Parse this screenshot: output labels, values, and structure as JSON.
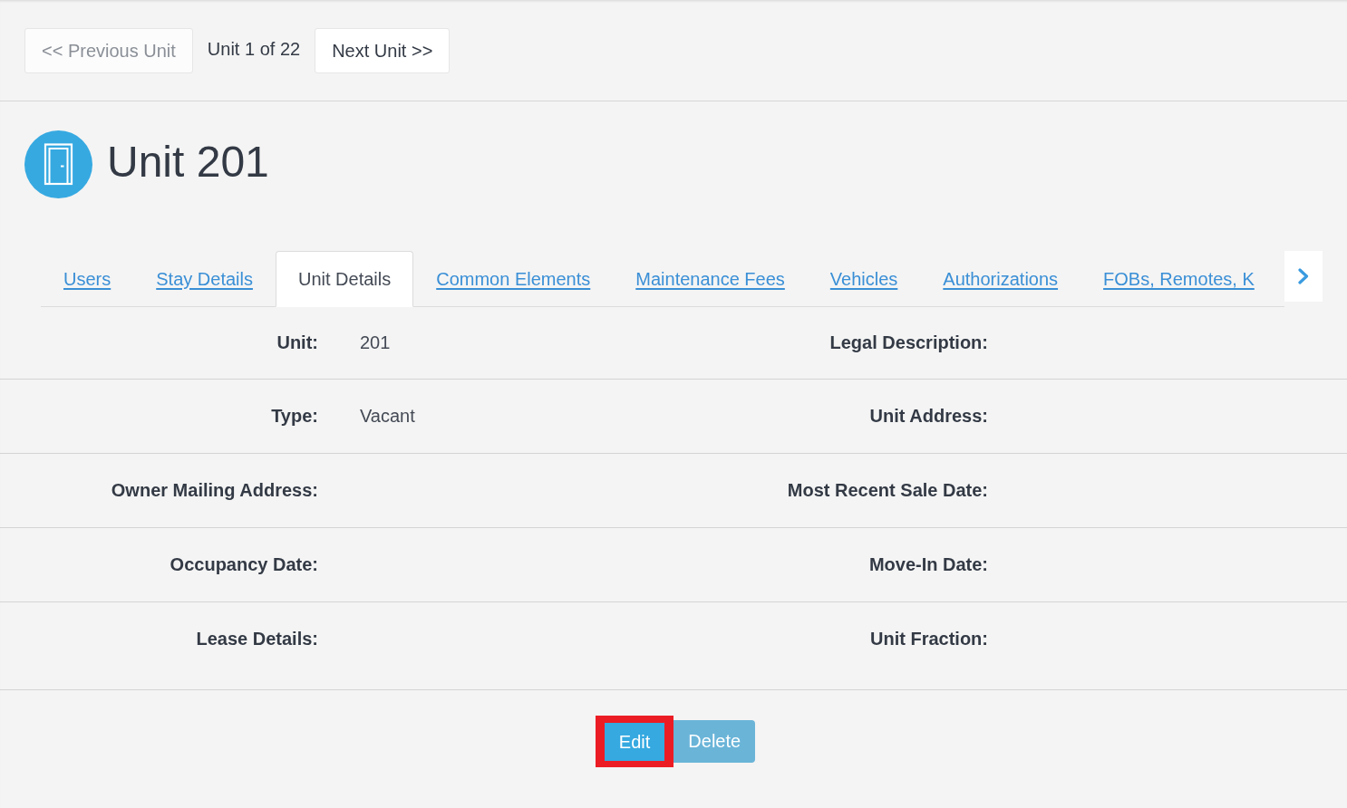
{
  "pager": {
    "previous": {
      "label": "<< Previous Unit",
      "disabled": true
    },
    "position": "Unit 1 of 22",
    "next": {
      "label": "Next Unit >>",
      "disabled": false
    }
  },
  "header": {
    "title": "Unit 201"
  },
  "tabs": [
    {
      "label": "Users",
      "selected": false
    },
    {
      "label": "Stay Details",
      "selected": false
    },
    {
      "label": "Unit Details",
      "selected": true
    },
    {
      "label": "Common Elements",
      "selected": false
    },
    {
      "label": "Maintenance Fees",
      "selected": false
    },
    {
      "label": "Vehicles",
      "selected": false
    },
    {
      "label": "Authorizations",
      "selected": false
    },
    {
      "label": "FOBs, Remotes, K",
      "selected": false
    }
  ],
  "details": {
    "rows": [
      {
        "left": {
          "label": "Unit:",
          "value": "201"
        },
        "right": {
          "label": "Legal Description:"
        }
      },
      {
        "left": {
          "label": "Type:",
          "value": "Vacant"
        },
        "right": {
          "label": "Unit Address:"
        }
      },
      {
        "left": {
          "label": "Owner Mailing Address:"
        },
        "right": {
          "label": "Most Recent Sale Date:"
        }
      },
      {
        "left": {
          "label": "Occupancy Date:"
        },
        "right": {
          "label": "Move-In Date:"
        }
      },
      {
        "left": {
          "label": "Lease Details:"
        },
        "right": {
          "label": "Unit Fraction:"
        }
      }
    ]
  },
  "actions": [
    {
      "label": "Edit",
      "disabled": false,
      "highlighted": true
    },
    {
      "label": "Delete",
      "disabled": true,
      "highlighted": false
    }
  ]
}
